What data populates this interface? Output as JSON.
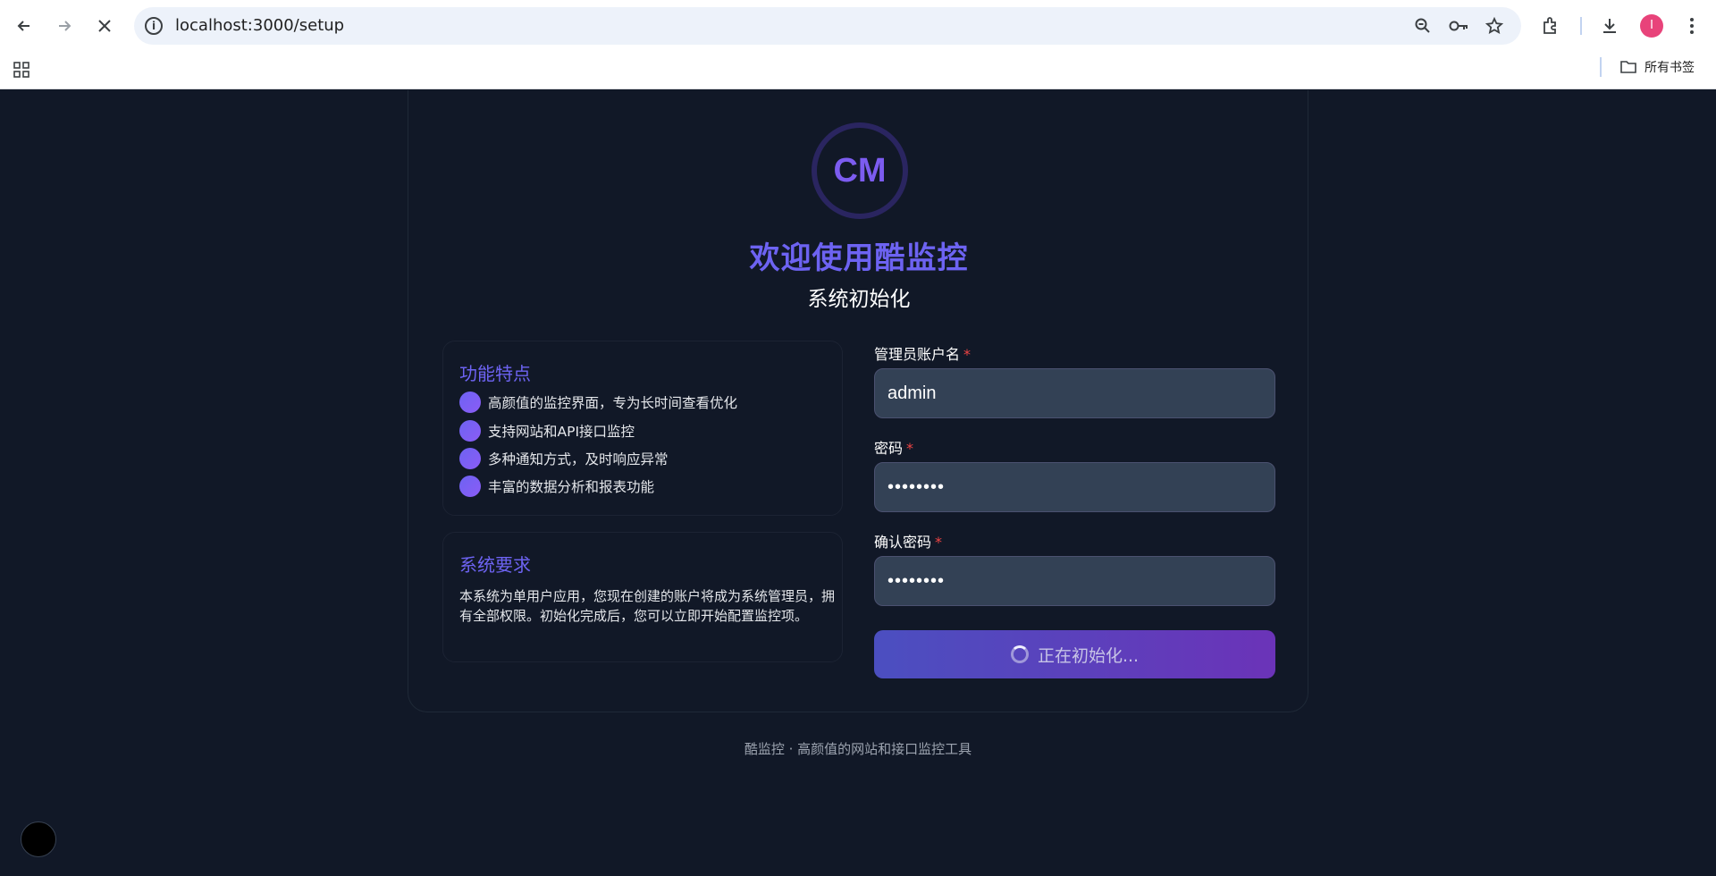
{
  "browser": {
    "url": "localhost:3000/setup",
    "avatar_letter": "I",
    "bookmarks_folder": "所有书签"
  },
  "setup": {
    "logo_text": "CM",
    "title": "欢迎使用酷监控",
    "subtitle": "系统初始化",
    "features": {
      "title": "功能特点",
      "items": [
        "高颜值的监控界面，专为长时间查看优化",
        "支持网站和API接口监控",
        "多种通知方式，及时响应异常",
        "丰富的数据分析和报表功能"
      ]
    },
    "requirements": {
      "title": "系统要求",
      "text": "本系统为单用户应用，您现在创建的账户将成为系统管理员，拥有全部权限。初始化完成后，您可以立即开始配置监控项。"
    },
    "form": {
      "username_label": "管理员账户名",
      "username_value": "admin",
      "password_label": "密码",
      "password_value": "••••••••",
      "confirm_label": "确认密码",
      "confirm_value": "••••••••",
      "required_mark": "*",
      "submit_label": "正在初始化..."
    },
    "footer": "酷监控 · 高颜值的网站和接口监控工具"
  },
  "icons": [
    "back-icon",
    "forward-icon",
    "stop-icon",
    "info-icon",
    "zoom-icon",
    "key-icon",
    "star-icon",
    "extensions-icon",
    "download-icon",
    "menu-icon",
    "apps-icon",
    "folder-icon",
    "spinner-icon"
  ]
}
